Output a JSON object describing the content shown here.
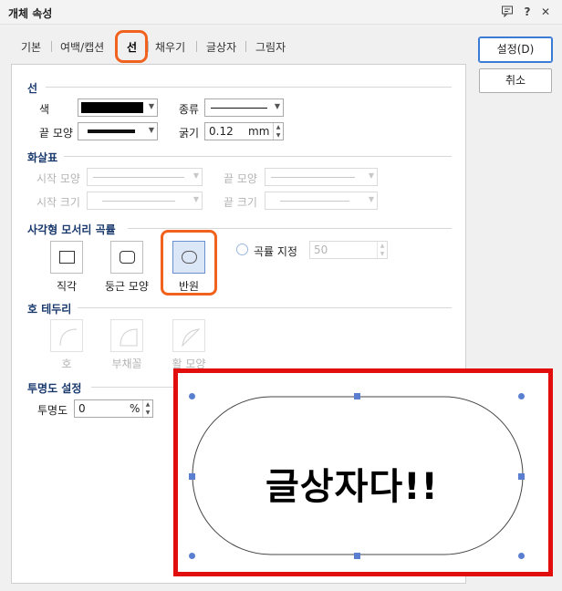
{
  "window": {
    "title": "개체 속성"
  },
  "titlebar_icons": [
    {
      "name": "chat-icon",
      "glyph": "🗨"
    },
    {
      "name": "help-icon",
      "glyph": "?"
    },
    {
      "name": "close-icon",
      "glyph": "✕"
    }
  ],
  "tabs": [
    "기본",
    "여백/캡션",
    "선",
    "채우기",
    "글상자",
    "그림자"
  ],
  "active_tab": "선",
  "buttons": {
    "ok": "설정(D)",
    "cancel": "취소"
  },
  "line_section": {
    "title": "선",
    "color_label": "색",
    "type_label": "종류",
    "end_label": "끝 모양",
    "thickness_label": "굵기",
    "thickness_value": "0.12",
    "thickness_unit": "mm"
  },
  "arrow_section": {
    "title": "화살표",
    "start_shape": "시작 모양",
    "end_shape": "끝 모양",
    "start_size": "시작 크기",
    "end_size": "끝 크기"
  },
  "corner_section": {
    "title": "사각형 모서리 곡률",
    "options": [
      "직각",
      "둥근 모양",
      "반원"
    ],
    "selected": "반원",
    "custom_label": "곡률 지정",
    "custom_value": "50"
  },
  "arc_section": {
    "title": "호 테두리",
    "options": [
      "호",
      "부채꼴",
      "활 모양"
    ]
  },
  "opacity_section": {
    "title": "투명도 설정",
    "label": "투명도",
    "value": "0",
    "unit": "%"
  },
  "preview": {
    "text": "글상자다!!"
  },
  "colors": {
    "highlight": "#f0621d",
    "preview_border": "#e20d0d",
    "handle": "#5b7fd0",
    "section_title": "#1a3a6e"
  }
}
